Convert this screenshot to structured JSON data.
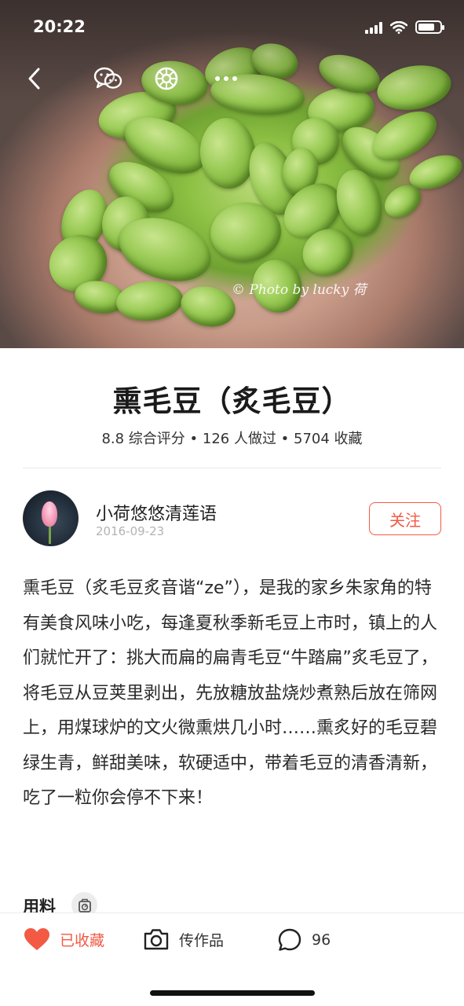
{
  "status_bar": {
    "time": "20:22",
    "icons": [
      "signal-icon",
      "wifi-icon",
      "battery-icon"
    ]
  },
  "hero": {
    "watermark": "© Photo by lucky 荷",
    "actions": [
      "back-icon",
      "wechat-icon",
      "moments-icon",
      "more-icon"
    ]
  },
  "recipe": {
    "title": "熏毛豆（炙毛豆）",
    "stats": "8.8 综合评分 • 126 人做过 • 5704 收藏"
  },
  "author": {
    "name": "小荷悠悠清莲语",
    "date": "2016-09-23",
    "follow_label": "关注"
  },
  "description": "熏毛豆（炙毛豆炙音谐“ze”），是我的家乡朱家角的特有美食风味小吃，每逢夏秋季新毛豆上市时，镇上的人们就忙开了：挑大而扁的扁青毛豆“牛踏扁”炙毛豆了，将毛豆从豆荚里剥出，先放糖放盐烧炒煮熟后放在筛网上，用煤球炉的文火微熏烘几小时……熏炙好的毛豆碧绿生青，鲜甜美味，软硬适中，带着毛豆的清香清新，吃了一粒你会停不下来！",
  "ingredients": {
    "title": "用料",
    "icon": "scale-icon"
  },
  "bottom_bar": {
    "favorite_label": "已收藏",
    "upload_label": "传作品",
    "comment_count": "96"
  },
  "colors": {
    "accent": "#f25a44",
    "text": "#222222",
    "muted": "#b3b3b3"
  }
}
